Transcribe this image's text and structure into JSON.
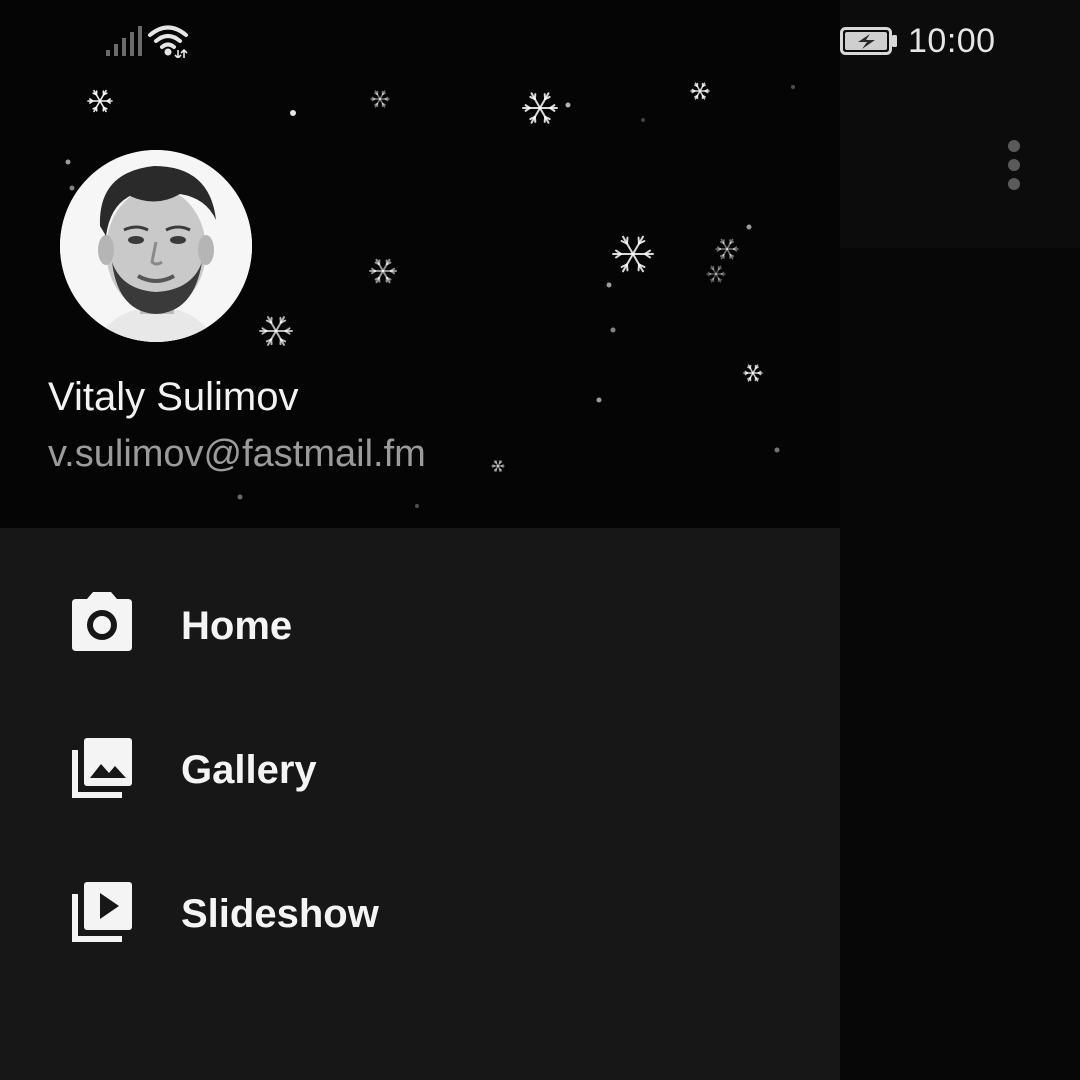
{
  "status_bar": {
    "time": "10:00",
    "signal_icon": "signal-bars-icon",
    "wifi_icon": "wifi-icon",
    "battery_icon": "battery-charging-icon"
  },
  "app_bar": {
    "overflow_icon": "more-vert-icon"
  },
  "drawer": {
    "header": {
      "name": "Vitaly Sulimov",
      "email": "v.sulimov@fastmail.fm",
      "avatar_icon": "profile-photo",
      "background": "snowfall"
    },
    "items": [
      {
        "label": "Home",
        "icon": "camera-icon"
      },
      {
        "label": "Gallery",
        "icon": "photo-library-icon"
      },
      {
        "label": "Slideshow",
        "icon": "slideshow-icon"
      }
    ]
  },
  "colors": {
    "drawer_background": "#171717",
    "header_background": "#050505",
    "scrim": "#070707",
    "text_primary": "#f4f4f4",
    "text_secondary": "#9b9b9b"
  }
}
